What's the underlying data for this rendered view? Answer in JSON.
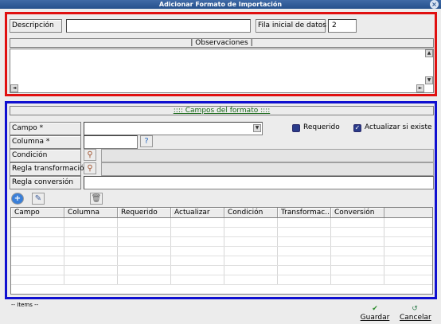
{
  "window": {
    "title": "Adicionar Formato de Importación",
    "close_glyph": "×"
  },
  "header_section": {
    "descripcion_label": "Descripción",
    "descripcion_value": "",
    "fila_label": "Fila inicial de datos",
    "fila_value": "2",
    "observaciones_label": "|   Observaciones   |"
  },
  "campos_section": {
    "title": "::::  Campos del formato  ::::",
    "campo_label": "Campo *",
    "columna_label": "Columna *",
    "condicion_label": "Condición",
    "regla_transformacion_label": "Regla transformación",
    "regla_conversion_label": "Regla conversión",
    "requerido_label": "Requerido",
    "actualizar_label": "Actualizar si existe",
    "requerido_checked": false,
    "actualizar_checked": true
  },
  "grid": {
    "columns": [
      "Campo",
      "Columna",
      "Requerido",
      "Actualizar",
      "Condición",
      "Transformac...",
      "Conversión"
    ],
    "row_count": 7
  },
  "footer": {
    "items_label": "-- Items --",
    "guardar_label": "Guardar",
    "cancelar_label": "Cancelar"
  },
  "colors": {
    "red_frame": "#e01010",
    "blue_frame": "#1010d0",
    "titlebar": "#25508c"
  },
  "icons": [
    "close-icon",
    "search-icon",
    "help-icon",
    "add-icon",
    "edit-icon",
    "delete-icon",
    "checkmark-icon",
    "cancel-icon"
  ]
}
